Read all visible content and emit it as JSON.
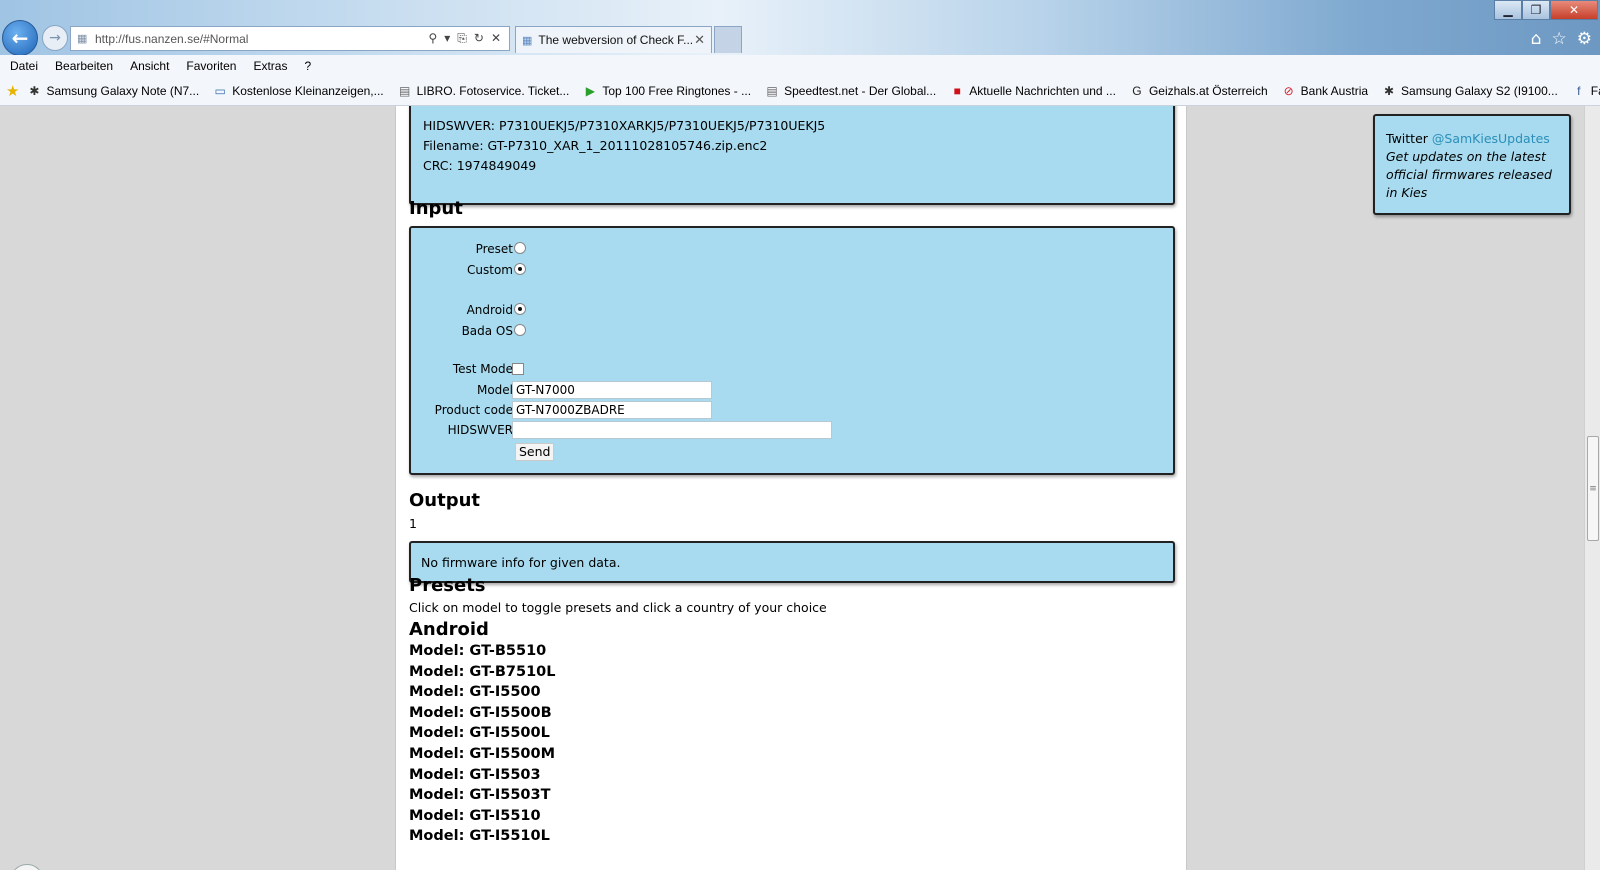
{
  "browser": {
    "url": "http://fus.nanzen.se/#Normal",
    "tab_title": "The webversion of Check F...",
    "window_controls": {
      "min": "▁",
      "max": "❐",
      "close": "✕"
    },
    "nav_icons": {
      "back": "←",
      "forward": "→"
    },
    "addr_tools": [
      "⚲",
      "▾",
      "⎘",
      "↻",
      "✕"
    ],
    "right_tools": [
      "⌂",
      "☆",
      "⚙"
    ]
  },
  "menu": [
    "Datei",
    "Bearbeiten",
    "Ansicht",
    "Favoriten",
    "Extras",
    "?"
  ],
  "favorites": [
    {
      "label": "Samsung Galaxy Note (N7...",
      "icon": "android-icon",
      "glyph": "✱",
      "color": "#333"
    },
    {
      "label": "Kostenlose Kleinanzeigen,...",
      "icon": "chat-icon",
      "glyph": "▭",
      "color": "#3a72b0"
    },
    {
      "label": "LIBRO. Fotoservice. Ticket...",
      "icon": "page-icon",
      "glyph": "▤",
      "color": "#666"
    },
    {
      "label": "Top 100 Free Ringtones - ...",
      "icon": "play-icon",
      "glyph": "▶",
      "color": "#2aa02a"
    },
    {
      "label": "Speedtest.net - Der Global...",
      "icon": "page-icon",
      "glyph": "▤",
      "color": "#666"
    },
    {
      "label": "Aktuelle Nachrichten und ...",
      "icon": "news-icon",
      "glyph": "■",
      "color": "#d0101a"
    },
    {
      "label": "Geizhals.at Österreich",
      "icon": "g-icon",
      "glyph": "G",
      "color": "#222"
    },
    {
      "label": "Bank Austria",
      "icon": "bank-icon",
      "glyph": "⊘",
      "color": "#d0202a"
    },
    {
      "label": "Samsung Galaxy S2 (I9100...",
      "icon": "android-icon",
      "glyph": "✱",
      "color": "#333"
    },
    {
      "label": "Facebook",
      "icon": "facebook-icon",
      "glyph": "f",
      "color": "#3b5998"
    }
  ],
  "firmware": {
    "hidswver_line": "HIDSWVER: P7310UEKJ5/P7310XARKJ5/P7310UEKJ5/P7310UEKJ5",
    "filename_line": "Filename: GT-P7310_XAR_1_20111028105746.zip.enc2",
    "crc_line": "CRC: 1974849049"
  },
  "input": {
    "heading": "Input",
    "preset_label": "Preset",
    "custom_label": "Custom",
    "android_label": "Android",
    "bada_label": "Bada OS",
    "testmode_label": "Test Mode",
    "model_label": "Model",
    "model_value": "GT-N7000",
    "product_code_label": "Product code",
    "product_code_value": "GT-N7000ZBADRE",
    "hidswver_label": "HIDSWVER",
    "hidswver_value": "",
    "send_label": "Send",
    "mode_selected": "Custom",
    "os_selected": "Android",
    "test_mode_checked": false
  },
  "output": {
    "heading": "Output",
    "counter": "1",
    "message": "No firmware info for given data."
  },
  "presets": {
    "heading": "Presets",
    "description": "Click on model to toggle presets and click a country of your choice",
    "android_heading": "Android",
    "models": [
      "Model: GT-B5510",
      "Model: GT-B7510L",
      "Model: GT-I5500",
      "Model: GT-I5500B",
      "Model: GT-I5500L",
      "Model: GT-I5500M",
      "Model: GT-I5503",
      "Model: GT-I5503T",
      "Model: GT-I5510",
      "Model: GT-I5510L"
    ]
  },
  "twitter": {
    "title": "Twitter",
    "handle": "@SamKiesUpdates",
    "text": "Get updates on the latest official firmwares released in Kies"
  },
  "colors": {
    "panel": "#a8dbef",
    "link": "#2a8fb8"
  }
}
